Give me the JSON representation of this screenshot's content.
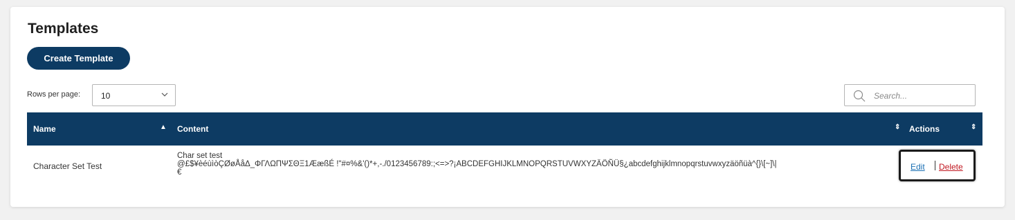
{
  "page": {
    "title": "Templates"
  },
  "toolbar": {
    "create_label": "Create Template"
  },
  "pagination": {
    "rows_label": "Rows per page:",
    "rows_value": "10"
  },
  "search": {
    "placeholder": "Search..."
  },
  "table": {
    "headers": {
      "name": "Name",
      "content": "Content",
      "actions": "Actions"
    },
    "sort": {
      "name_indicator": "▲",
      "content_indicator": "⇕",
      "actions_indicator": "⇕"
    },
    "rows": [
      {
        "name": "Character Set Test",
        "content": "Char set test\n@£$¥èéùìòÇØøÅåΔ_ΦΓΛΩΠΨΣΘΞ1ÆæßÉ !\"#¤%&'()*+,-./0123456789:;<=>?¡ABCDEFGHIJKLMNOPQRSTUVWXYZÄÖÑÜ§¿abcdefghijklmnopqrstuvwxyzäöñüà^{}\\[~]\\|\n€",
        "actions": {
          "edit": "Edit",
          "delete": "Delete"
        }
      }
    ]
  },
  "colors": {
    "header_bg": "#0d3b63",
    "button_bg": "#0d3b63",
    "link_edit": "#1a6fb3",
    "link_delete": "#c0161f"
  }
}
